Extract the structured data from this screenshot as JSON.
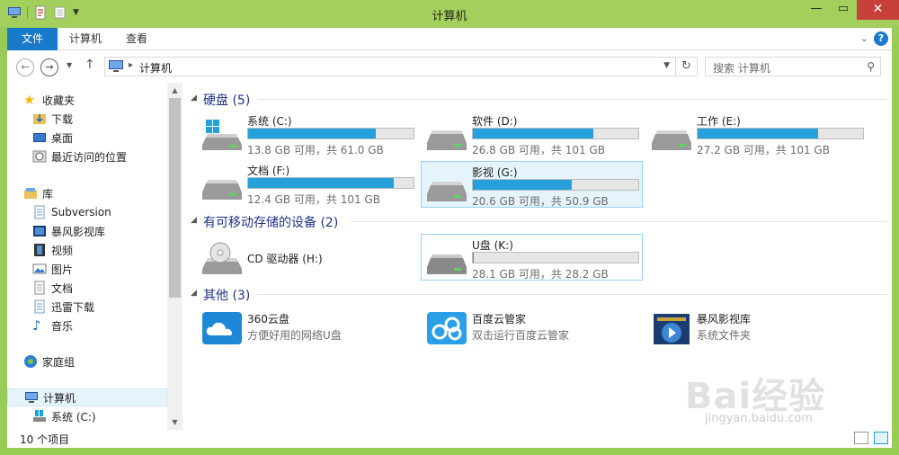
{
  "window": {
    "title": "计算机"
  },
  "ribbon": {
    "tabs": [
      "文件",
      "计算机",
      "查看"
    ]
  },
  "address": {
    "path": "计算机"
  },
  "search": {
    "placeholder": "搜索 计算机"
  },
  "nav": {
    "favorites": {
      "label": "收藏夹",
      "items": [
        "下载",
        "桌面",
        "最近访问的位置"
      ]
    },
    "libraries": {
      "label": "库",
      "items": [
        "Subversion",
        "暴风影视库",
        "视频",
        "图片",
        "文档",
        "迅雷下载",
        "音乐"
      ]
    },
    "homegroup": "家庭组",
    "computer": "计算机",
    "computer_child": "系统 (C:)"
  },
  "groups": {
    "hdd": {
      "title": "硬盘 (5)",
      "drives": [
        {
          "name": "系统 (C:)",
          "info": "13.8 GB 可用，共 61.0 GB",
          "used": 0.77
        },
        {
          "name": "软件 (D:)",
          "info": "26.8 GB 可用，共 101 GB",
          "used": 0.73
        },
        {
          "name": "工作 (E:)",
          "info": "27.2 GB 可用，共 101 GB",
          "used": 0.73
        },
        {
          "name": "文档 (F:)",
          "info": "12.4 GB 可用，共 101 GB",
          "used": 0.88
        },
        {
          "name": "影视 (G:)",
          "info": "20.6 GB 可用，共 50.9 GB",
          "used": 0.6
        }
      ]
    },
    "removable": {
      "title": "有可移动存储的设备 (2)",
      "cd": {
        "name": "CD 驱动器 (H:)"
      },
      "usb": {
        "name": "U盘 (K:)",
        "info": "28.1 GB 可用，共 28.2 GB",
        "used": 0.004
      }
    },
    "other": {
      "title": "其他 (3)",
      "items": [
        {
          "name": "360云盘",
          "sub": "方便好用的网络U盘"
        },
        {
          "name": "百度云管家",
          "sub": "双击运行百度云管家"
        },
        {
          "name": "暴风影视库",
          "sub": "系统文件夹"
        }
      ]
    }
  },
  "status": {
    "count": "10 个项目"
  },
  "watermark": {
    "brand": "Bai经验",
    "url": "jingyan.baidu.com"
  },
  "colors": {
    "accent": "#1979ca",
    "bar": "#26a0da",
    "frame": "#99cc55",
    "group_title": "#1e3287",
    "close": "#c7413a"
  }
}
